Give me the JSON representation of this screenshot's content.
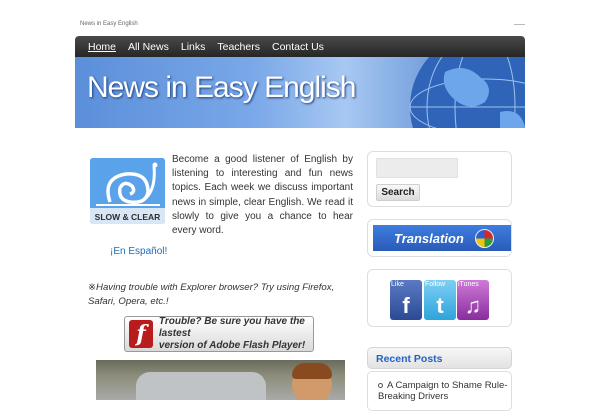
{
  "site": {
    "description": "News in Easy English",
    "banner_title": "News in Easy English"
  },
  "nav": {
    "items": [
      {
        "label": "Home",
        "active": true
      },
      {
        "label": "All News",
        "active": false
      },
      {
        "label": "Links",
        "active": false
      },
      {
        "label": "Teachers",
        "active": false
      },
      {
        "label": "Contact Us",
        "active": false
      }
    ]
  },
  "main": {
    "logo_caption": "SLOW & CLEAR",
    "intro": "Become a good listener of English by listening to interesting and fun news topics. Each week we discuss important news in simple, clear English. We read it slowly to give you a chance to hear every word.",
    "espanol_link": "¡En Español!",
    "notice_mark": "※",
    "notice": "Having trouble with Explorer browser? Try using Firefox, Safari, Opera, etc.!",
    "flash_banner": {
      "line1": "Trouble? Be sure you have the lastest",
      "line2": "version of Adobe Flash Player!",
      "icon": "flash-icon"
    }
  },
  "sidebar": {
    "search": {
      "placeholder": "",
      "button_label": "Search"
    },
    "translation_label": "Translation",
    "social": [
      {
        "label": "Like",
        "glyph": "f",
        "icon": "facebook-icon"
      },
      {
        "label": "Follow",
        "glyph": "t",
        "icon": "twitter-icon"
      },
      {
        "label": "iTunes",
        "glyph": "♫",
        "icon": "itunes-icon"
      }
    ],
    "recent_posts": {
      "heading": "Recent Posts",
      "items": [
        "A Campaign to Shame Rule-Breaking Drivers"
      ]
    }
  },
  "colors": {
    "nav_bg": "#2f2f2f",
    "link": "#1a6fb5",
    "recent_heading": "#2463c5",
    "banner_blue": "#5b8fda"
  }
}
